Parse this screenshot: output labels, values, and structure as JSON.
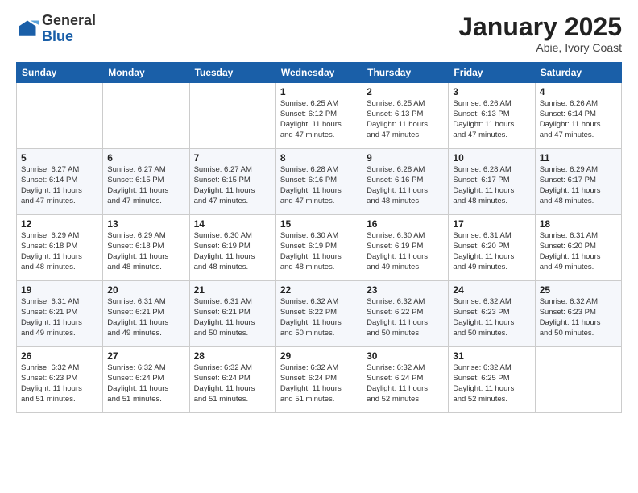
{
  "logo": {
    "general": "General",
    "blue": "Blue"
  },
  "header": {
    "month": "January 2025",
    "location": "Abie, Ivory Coast"
  },
  "weekdays": [
    "Sunday",
    "Monday",
    "Tuesday",
    "Wednesday",
    "Thursday",
    "Friday",
    "Saturday"
  ],
  "weeks": [
    [
      {
        "day": "",
        "info": ""
      },
      {
        "day": "",
        "info": ""
      },
      {
        "day": "",
        "info": ""
      },
      {
        "day": "1",
        "info": "Sunrise: 6:25 AM\nSunset: 6:12 PM\nDaylight: 11 hours\nand 47 minutes."
      },
      {
        "day": "2",
        "info": "Sunrise: 6:25 AM\nSunset: 6:13 PM\nDaylight: 11 hours\nand 47 minutes."
      },
      {
        "day": "3",
        "info": "Sunrise: 6:26 AM\nSunset: 6:13 PM\nDaylight: 11 hours\nand 47 minutes."
      },
      {
        "day": "4",
        "info": "Sunrise: 6:26 AM\nSunset: 6:14 PM\nDaylight: 11 hours\nand 47 minutes."
      }
    ],
    [
      {
        "day": "5",
        "info": "Sunrise: 6:27 AM\nSunset: 6:14 PM\nDaylight: 11 hours\nand 47 minutes."
      },
      {
        "day": "6",
        "info": "Sunrise: 6:27 AM\nSunset: 6:15 PM\nDaylight: 11 hours\nand 47 minutes."
      },
      {
        "day": "7",
        "info": "Sunrise: 6:27 AM\nSunset: 6:15 PM\nDaylight: 11 hours\nand 47 minutes."
      },
      {
        "day": "8",
        "info": "Sunrise: 6:28 AM\nSunset: 6:16 PM\nDaylight: 11 hours\nand 47 minutes."
      },
      {
        "day": "9",
        "info": "Sunrise: 6:28 AM\nSunset: 6:16 PM\nDaylight: 11 hours\nand 48 minutes."
      },
      {
        "day": "10",
        "info": "Sunrise: 6:28 AM\nSunset: 6:17 PM\nDaylight: 11 hours\nand 48 minutes."
      },
      {
        "day": "11",
        "info": "Sunrise: 6:29 AM\nSunset: 6:17 PM\nDaylight: 11 hours\nand 48 minutes."
      }
    ],
    [
      {
        "day": "12",
        "info": "Sunrise: 6:29 AM\nSunset: 6:18 PM\nDaylight: 11 hours\nand 48 minutes."
      },
      {
        "day": "13",
        "info": "Sunrise: 6:29 AM\nSunset: 6:18 PM\nDaylight: 11 hours\nand 48 minutes."
      },
      {
        "day": "14",
        "info": "Sunrise: 6:30 AM\nSunset: 6:19 PM\nDaylight: 11 hours\nand 48 minutes."
      },
      {
        "day": "15",
        "info": "Sunrise: 6:30 AM\nSunset: 6:19 PM\nDaylight: 11 hours\nand 48 minutes."
      },
      {
        "day": "16",
        "info": "Sunrise: 6:30 AM\nSunset: 6:19 PM\nDaylight: 11 hours\nand 49 minutes."
      },
      {
        "day": "17",
        "info": "Sunrise: 6:31 AM\nSunset: 6:20 PM\nDaylight: 11 hours\nand 49 minutes."
      },
      {
        "day": "18",
        "info": "Sunrise: 6:31 AM\nSunset: 6:20 PM\nDaylight: 11 hours\nand 49 minutes."
      }
    ],
    [
      {
        "day": "19",
        "info": "Sunrise: 6:31 AM\nSunset: 6:21 PM\nDaylight: 11 hours\nand 49 minutes."
      },
      {
        "day": "20",
        "info": "Sunrise: 6:31 AM\nSunset: 6:21 PM\nDaylight: 11 hours\nand 49 minutes."
      },
      {
        "day": "21",
        "info": "Sunrise: 6:31 AM\nSunset: 6:21 PM\nDaylight: 11 hours\nand 50 minutes."
      },
      {
        "day": "22",
        "info": "Sunrise: 6:32 AM\nSunset: 6:22 PM\nDaylight: 11 hours\nand 50 minutes."
      },
      {
        "day": "23",
        "info": "Sunrise: 6:32 AM\nSunset: 6:22 PM\nDaylight: 11 hours\nand 50 minutes."
      },
      {
        "day": "24",
        "info": "Sunrise: 6:32 AM\nSunset: 6:23 PM\nDaylight: 11 hours\nand 50 minutes."
      },
      {
        "day": "25",
        "info": "Sunrise: 6:32 AM\nSunset: 6:23 PM\nDaylight: 11 hours\nand 50 minutes."
      }
    ],
    [
      {
        "day": "26",
        "info": "Sunrise: 6:32 AM\nSunset: 6:23 PM\nDaylight: 11 hours\nand 51 minutes."
      },
      {
        "day": "27",
        "info": "Sunrise: 6:32 AM\nSunset: 6:24 PM\nDaylight: 11 hours\nand 51 minutes."
      },
      {
        "day": "28",
        "info": "Sunrise: 6:32 AM\nSunset: 6:24 PM\nDaylight: 11 hours\nand 51 minutes."
      },
      {
        "day": "29",
        "info": "Sunrise: 6:32 AM\nSunset: 6:24 PM\nDaylight: 11 hours\nand 51 minutes."
      },
      {
        "day": "30",
        "info": "Sunrise: 6:32 AM\nSunset: 6:24 PM\nDaylight: 11 hours\nand 52 minutes."
      },
      {
        "day": "31",
        "info": "Sunrise: 6:32 AM\nSunset: 6:25 PM\nDaylight: 11 hours\nand 52 minutes."
      },
      {
        "day": "",
        "info": ""
      }
    ]
  ]
}
